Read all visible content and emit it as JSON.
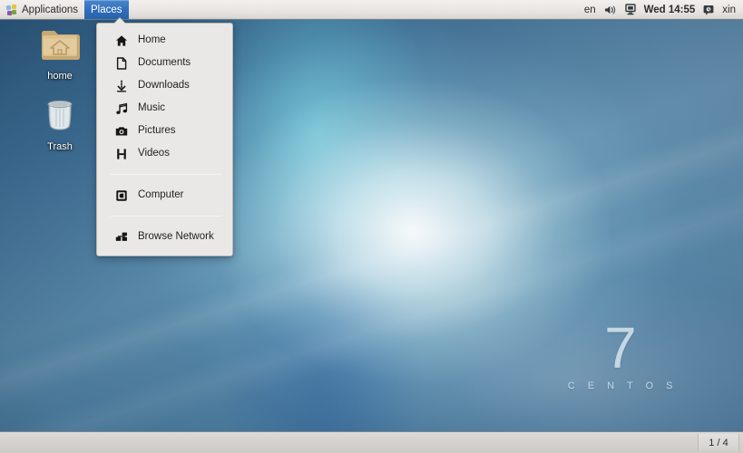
{
  "top_panel": {
    "applications": {
      "label": "Applications",
      "icon": "applications-grid-icon"
    },
    "places": {
      "label": "Places",
      "icon": "places-menu-icon",
      "active": true
    },
    "tray": {
      "keyboard_layout": "en",
      "volume_icon": "speaker-icon",
      "display_icon": "display-icon",
      "clock": "Wed 14:55",
      "user_icon": "user-status-icon",
      "user_name": "xin"
    }
  },
  "places_menu": {
    "items": [
      {
        "label": "Home",
        "icon": "home-icon"
      },
      {
        "label": "Documents",
        "icon": "document-icon"
      },
      {
        "label": "Downloads",
        "icon": "download-icon"
      },
      {
        "label": "Music",
        "icon": "music-note-icon"
      },
      {
        "label": "Pictures",
        "icon": "camera-icon"
      },
      {
        "label": "Videos",
        "icon": "film-icon"
      },
      {
        "label": "Computer",
        "icon": "computer-icon"
      },
      {
        "label": "Browse Network",
        "icon": "network-icon"
      }
    ]
  },
  "desktop": {
    "icons": [
      {
        "label": "home",
        "icon": "home-folder-icon"
      },
      {
        "label": "Trash",
        "icon": "trash-can-icon"
      }
    ],
    "watermark": {
      "version": "7",
      "name": "C E N T O S"
    }
  },
  "bottom_panel": {
    "workspace_indicator": "1 / 4"
  },
  "colors": {
    "accent_blue": "#2e6db8",
    "panel_gray": "#eae7e4",
    "menu_bg": "#e9e8e6",
    "desktop_blue": "#4e7fa2"
  }
}
